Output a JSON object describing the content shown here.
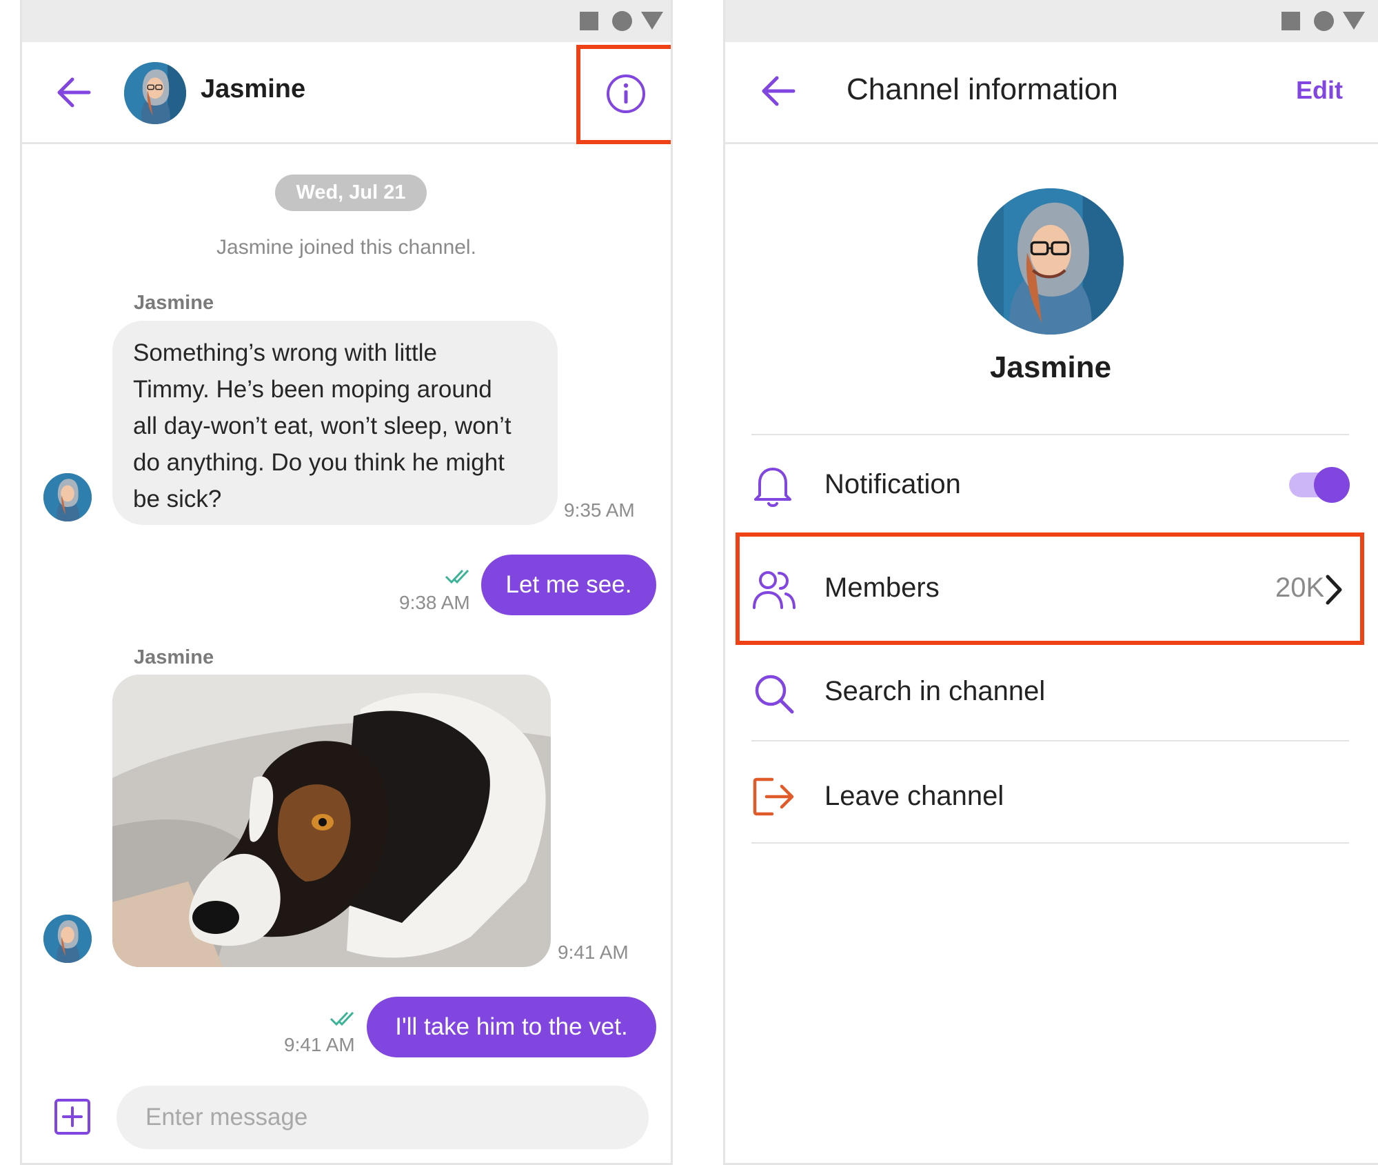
{
  "colors": {
    "accent": "#8146e0",
    "highlight": "#ee4116",
    "leave": "#e05a2a",
    "read_check": "#3bb396"
  },
  "left": {
    "header": {
      "title": "Jasmine",
      "back_icon": "arrow-left-icon",
      "info_icon": "info-icon"
    },
    "date_separator": "Wed, Jul 21",
    "system_message": "Jasmine joined this channel.",
    "messages": [
      {
        "sender": "Jasmine",
        "lines": [
          "Something’s wrong with little",
          "Timmy. He’s been moping around",
          "all day-won’t eat, won’t sleep, won’t",
          "do anything. Do you think he might",
          "be sick?"
        ],
        "time": "9:35 AM"
      },
      {
        "text": "Let me see.",
        "time": "9:38 AM"
      },
      {
        "sender": "Jasmine",
        "image": "dog-photo",
        "time": "9:41 AM"
      },
      {
        "text": "I'll take him to the vet.",
        "time": "9:41 AM"
      }
    ],
    "composer": {
      "placeholder": "Enter message",
      "add_icon": "add-square-icon"
    }
  },
  "right": {
    "header": {
      "title": "Channel information",
      "edit": "Edit",
      "back_icon": "arrow-left-icon"
    },
    "profile": {
      "name": "Jasmine"
    },
    "rows": {
      "notification": {
        "label": "Notification",
        "icon": "bell-icon",
        "toggle_on": true
      },
      "members": {
        "label": "Members",
        "count": "20K",
        "icon": "members-icon"
      },
      "search": {
        "label": "Search in channel",
        "icon": "search-icon"
      },
      "leave": {
        "label": "Leave channel",
        "icon": "leave-icon"
      }
    }
  }
}
